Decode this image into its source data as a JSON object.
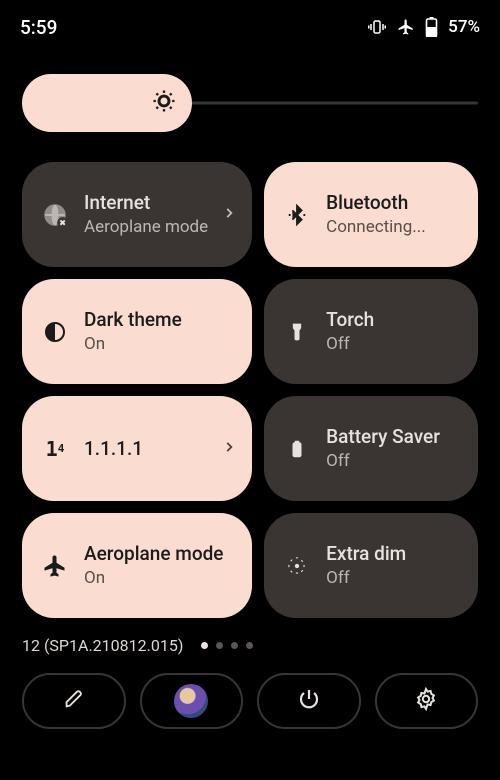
{
  "statusbar": {
    "time": "5:59",
    "battery_text": "57%"
  },
  "tiles": {
    "internet": {
      "title": "Internet",
      "subtitle": "Aeroplane mode"
    },
    "bluetooth": {
      "title": "Bluetooth",
      "subtitle": "Connecting..."
    },
    "darktheme": {
      "title": "Dark theme",
      "subtitle": "On"
    },
    "torch": {
      "title": "Torch",
      "subtitle": "Off"
    },
    "dns": {
      "title": "1.1.1.1",
      "subtitle": ""
    },
    "batterysaver": {
      "title": "Battery Saver",
      "subtitle": "Off"
    },
    "aeroplane": {
      "title": "Aeroplane mode",
      "subtitle": "On"
    },
    "extradim": {
      "title": "Extra dim",
      "subtitle": "Off"
    }
  },
  "build": "12 (SP1A.210812.015)",
  "pager": {
    "count": 4,
    "active": 0
  },
  "colors": {
    "on_bg": "#fadcd1",
    "off_bg": "#3a3533"
  }
}
